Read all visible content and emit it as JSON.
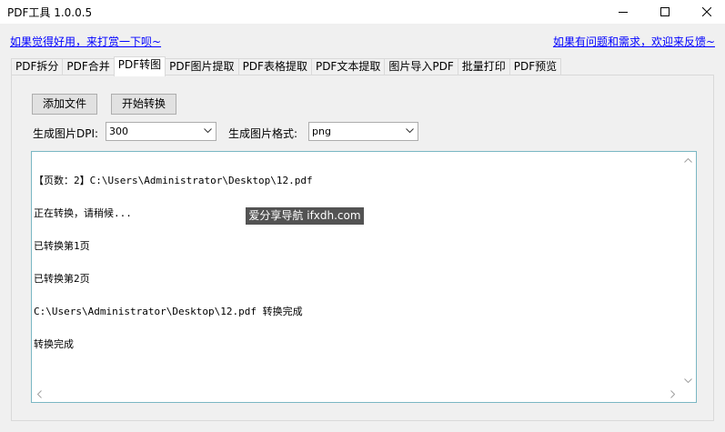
{
  "window": {
    "title": "PDF工具 1.0.0.5",
    "minimize_icon": "minimize-icon",
    "maximize_icon": "maximize-icon",
    "close_icon": "close-icon"
  },
  "links": {
    "left": "如果觉得好用，来打赏一下呗~",
    "right": "如果有问题和需求，欢迎来反馈~"
  },
  "tabs": [
    {
      "label": "PDF拆分",
      "active": false
    },
    {
      "label": "PDF合并",
      "active": false
    },
    {
      "label": "PDF转图",
      "active": true
    },
    {
      "label": "PDF图片提取",
      "active": false
    },
    {
      "label": "PDF表格提取",
      "active": false
    },
    {
      "label": "PDF文本提取",
      "active": false
    },
    {
      "label": "图片导入PDF",
      "active": false
    },
    {
      "label": "批量打印",
      "active": false
    },
    {
      "label": "PDF预览",
      "active": false
    }
  ],
  "toolbar": {
    "add_file_label": "添加文件",
    "start_convert_label": "开始转换"
  },
  "options": {
    "dpi_label": "生成图片DPI:",
    "dpi_value": "300",
    "format_label": "生成图片格式:",
    "format_value": "png"
  },
  "output": {
    "lines": [
      "【页数：2】C:\\Users\\Administrator\\Desktop\\12.pdf",
      "正在转换，请稍候...",
      "已转换第1页",
      "已转换第2页",
      "C:\\Users\\Administrator\\Desktop\\12.pdf 转换完成",
      "转换完成"
    ]
  },
  "watermark": "爱分享导航 ifxdh.com"
}
